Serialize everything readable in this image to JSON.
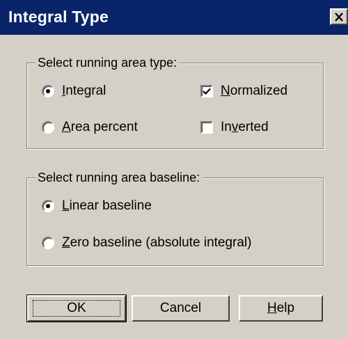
{
  "window": {
    "title": "Integral Type",
    "close_glyph": "✕"
  },
  "area_type_group": {
    "legend": "Select running area type:",
    "options": [
      {
        "pre": "",
        "accel": "I",
        "post": "ntegral",
        "selected": true
      },
      {
        "pre": "",
        "accel": "A",
        "post": "rea percent",
        "selected": false
      }
    ],
    "checkboxes": [
      {
        "pre": "",
        "accel": "N",
        "post": "ormalized",
        "checked": true
      },
      {
        "pre": "In",
        "accel": "v",
        "post": "erted",
        "checked": false
      }
    ]
  },
  "baseline_group": {
    "legend": "Select running area baseline:",
    "options": [
      {
        "pre": "",
        "accel": "L",
        "post": "inear baseline",
        "selected": true
      },
      {
        "pre": "",
        "accel": "Z",
        "post": "ero baseline (absolute integral)",
        "selected": false
      }
    ]
  },
  "buttons": {
    "ok": "OK",
    "cancel": "Cancel",
    "help_accel": "H",
    "help_rest": "elp"
  }
}
